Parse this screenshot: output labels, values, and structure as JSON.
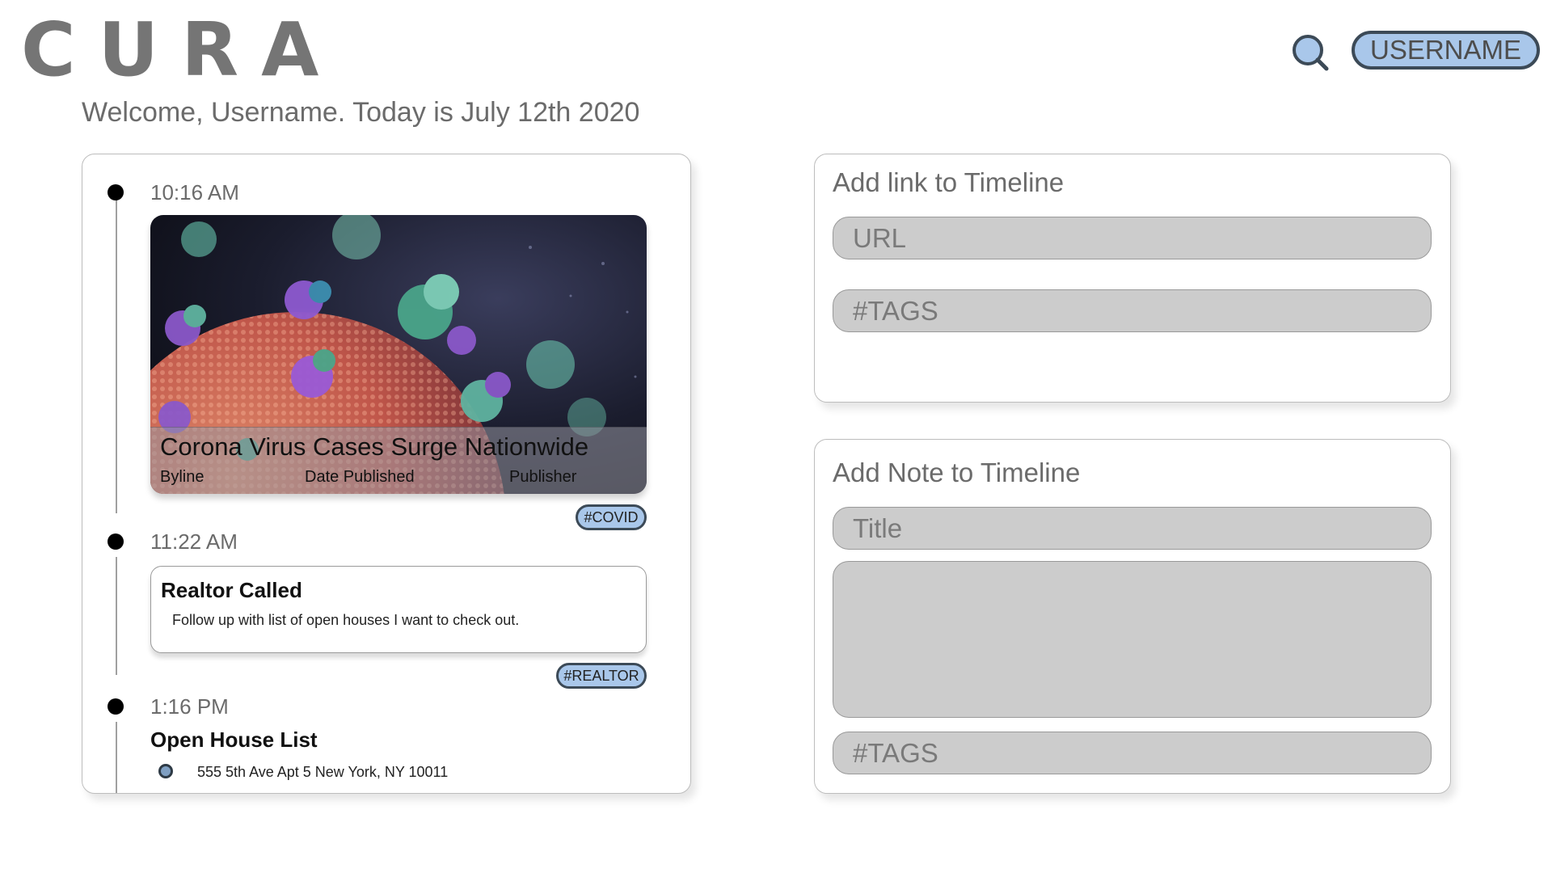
{
  "header": {
    "logo_letters": [
      "C",
      "U",
      "R",
      "A"
    ],
    "search_icon": "search-icon",
    "username_button": "USERNAME"
  },
  "welcome_text": "Welcome, Username. Today is July 12th 2020",
  "timeline": {
    "entries": [
      {
        "time": "10:16 AM",
        "type": "link",
        "title": "Corona Virus Cases Surge Nationwide",
        "byline": "Byline",
        "date_published": "Date Published",
        "publisher": "Publisher",
        "tag": "#COVID"
      },
      {
        "time": "11:22 AM",
        "type": "note",
        "title": "Realtor Called",
        "body": "Follow up with list of open houses I want to check out.",
        "tag": "#REALTOR"
      },
      {
        "time": "1:16 PM",
        "type": "list",
        "title": "Open House List",
        "items": [
          "555 5th Ave Apt 5 New York, NY 10011"
        ]
      }
    ]
  },
  "add_link_form": {
    "heading": "Add link to Timeline",
    "url_placeholder": "URL",
    "tags_placeholder": "#TAGS"
  },
  "add_note_form": {
    "heading": "Add Note to Timeline",
    "title_placeholder": "Title",
    "body_placeholder": "",
    "tags_placeholder": "#TAGS"
  },
  "colors": {
    "accent_pill": "#a9c7ea",
    "pill_border": "#3c4a57",
    "field_bg": "#cccccc",
    "logo": "#757575"
  }
}
